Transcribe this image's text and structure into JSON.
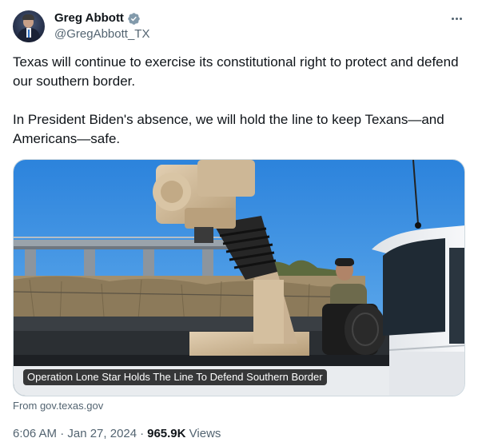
{
  "author": {
    "display_name": "Greg Abbott",
    "handle": "@GregAbbott_TX",
    "verified": true,
    "verified_badge_color": "#829aab"
  },
  "tweet": {
    "paragraphs": [
      "Texas will continue to exercise its constitutional right to protect and defend our southern border.",
      "In President Biden's absence, we will hold the line to keep Texans—and Americans—safe."
    ],
    "media": {
      "caption": "Operation Lone Star Holds The Line To Defend Southern Border"
    },
    "source": "From gov.texas.gov",
    "timestamp": "6:06 AM · Jan 27, 2024",
    "separator": "·",
    "views_count": "965.9K",
    "views_label": "Views"
  },
  "icons": {
    "more": "more-options-icon",
    "verified": "verified-badge-icon"
  },
  "colors": {
    "text_primary": "#0f1419",
    "text_secondary": "#536471",
    "border": "#cfd9de"
  }
}
